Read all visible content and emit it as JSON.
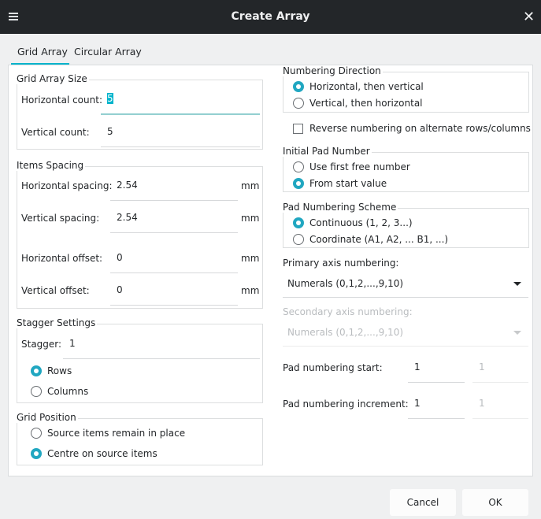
{
  "window": {
    "title": "Create Array"
  },
  "tabs": [
    {
      "label": "Grid Array",
      "active": true
    },
    {
      "label": "Circular Array",
      "active": false
    }
  ],
  "grid_array_size": {
    "title": "Grid Array Size",
    "horizontal_count_label": "Horizontal count:",
    "horizontal_count": "5",
    "vertical_count_label": "Vertical count:",
    "vertical_count": "5"
  },
  "items_spacing": {
    "title": "Items Spacing",
    "h_spacing_label": "Horizontal spacing:",
    "h_spacing": "2.54",
    "v_spacing_label": "Vertical spacing:",
    "v_spacing": "2.54",
    "h_offset_label": "Horizontal offset:",
    "h_offset": "0",
    "v_offset_label": "Vertical offset:",
    "v_offset": "0",
    "unit": "mm"
  },
  "stagger": {
    "title": "Stagger Settings",
    "stagger_label": "Stagger:",
    "stagger_value": "1",
    "rows": "Rows",
    "columns": "Columns",
    "selected": "Rows"
  },
  "grid_position": {
    "title": "Grid Position",
    "remain": "Source items remain in place",
    "centre": "Centre on source items",
    "selected": "Centre on source items"
  },
  "numbering_direction": {
    "title": "Numbering Direction",
    "h_then_v": "Horizontal, then vertical",
    "v_then_h": "Vertical, then horizontal",
    "selected": "Horizontal, then vertical"
  },
  "reverse": {
    "label": "Reverse numbering on alternate rows/columns",
    "checked": false
  },
  "initial_pad": {
    "title": "Initial Pad Number",
    "first_free": "Use first free number",
    "start_value": "From start value",
    "selected": "From start value"
  },
  "scheme": {
    "title": "Pad Numbering Scheme",
    "continuous": "Continuous (1, 2, 3...)",
    "coordinate": "Coordinate (A1, A2, ... B1, ...)",
    "selected": "Continuous (1, 2, 3...)"
  },
  "primary_axis": {
    "label": "Primary axis numbering:",
    "value": "Numerals (0,1,2,...,9,10)"
  },
  "secondary_axis": {
    "label": "Secondary axis numbering:",
    "value": "Numerals (0,1,2,...,9,10)",
    "disabled": true
  },
  "pad_start": {
    "label": "Pad numbering start:",
    "value": "1",
    "secondary": "1"
  },
  "pad_increment": {
    "label": "Pad numbering increment:",
    "value": "1",
    "secondary": "1"
  },
  "buttons": {
    "cancel": "Cancel",
    "ok": "OK"
  },
  "colors": {
    "accent": "#00b4cc",
    "titlebar": "#232629"
  }
}
